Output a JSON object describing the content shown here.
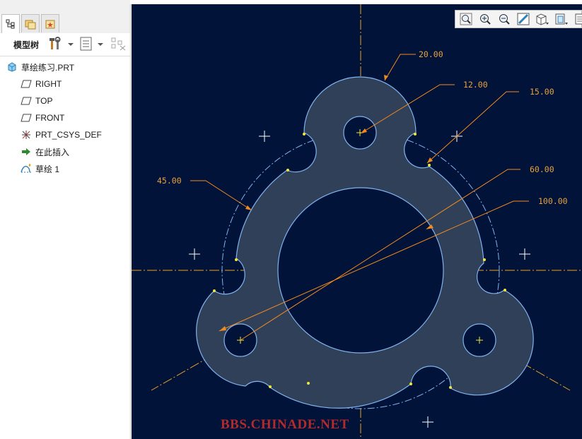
{
  "model_tree": {
    "header_label": "模型树",
    "items": [
      {
        "label": "草绘练习.PRT",
        "icon": "part-icon"
      },
      {
        "label": "RIGHT",
        "icon": "datum-plane-icon"
      },
      {
        "label": "TOP",
        "icon": "datum-plane-icon"
      },
      {
        "label": "FRONT",
        "icon": "datum-plane-icon"
      },
      {
        "label": "PRT_CSYS_DEF",
        "icon": "csys-icon"
      },
      {
        "label": "在此插入",
        "icon": "insert-here-arrow-icon"
      },
      {
        "label": "草绘 1",
        "icon": "sketch-icon"
      }
    ]
  },
  "view_toolbar": {
    "buttons": [
      "refit-icon",
      "zoom-in-icon",
      "zoom-out-icon",
      "repaint-icon",
      "saved-orientations-icon",
      "display-style-icon",
      "more-icon"
    ]
  },
  "sketch": {
    "dimensions": {
      "d1": "20.00",
      "d2": "12.00",
      "d3": "15.00",
      "d4": "45.00",
      "d5": "60.00",
      "d6": "100.00"
    },
    "colors": {
      "background": "#02133a",
      "geometry": "#7fb4ee",
      "dimension": "#f08a1e",
      "dimension_text": "#e8a23c",
      "centerline": "#e6a020",
      "vertex": "#f2e638",
      "fill": "#304059"
    }
  },
  "watermark": "BBS.CHINADE.NET"
}
